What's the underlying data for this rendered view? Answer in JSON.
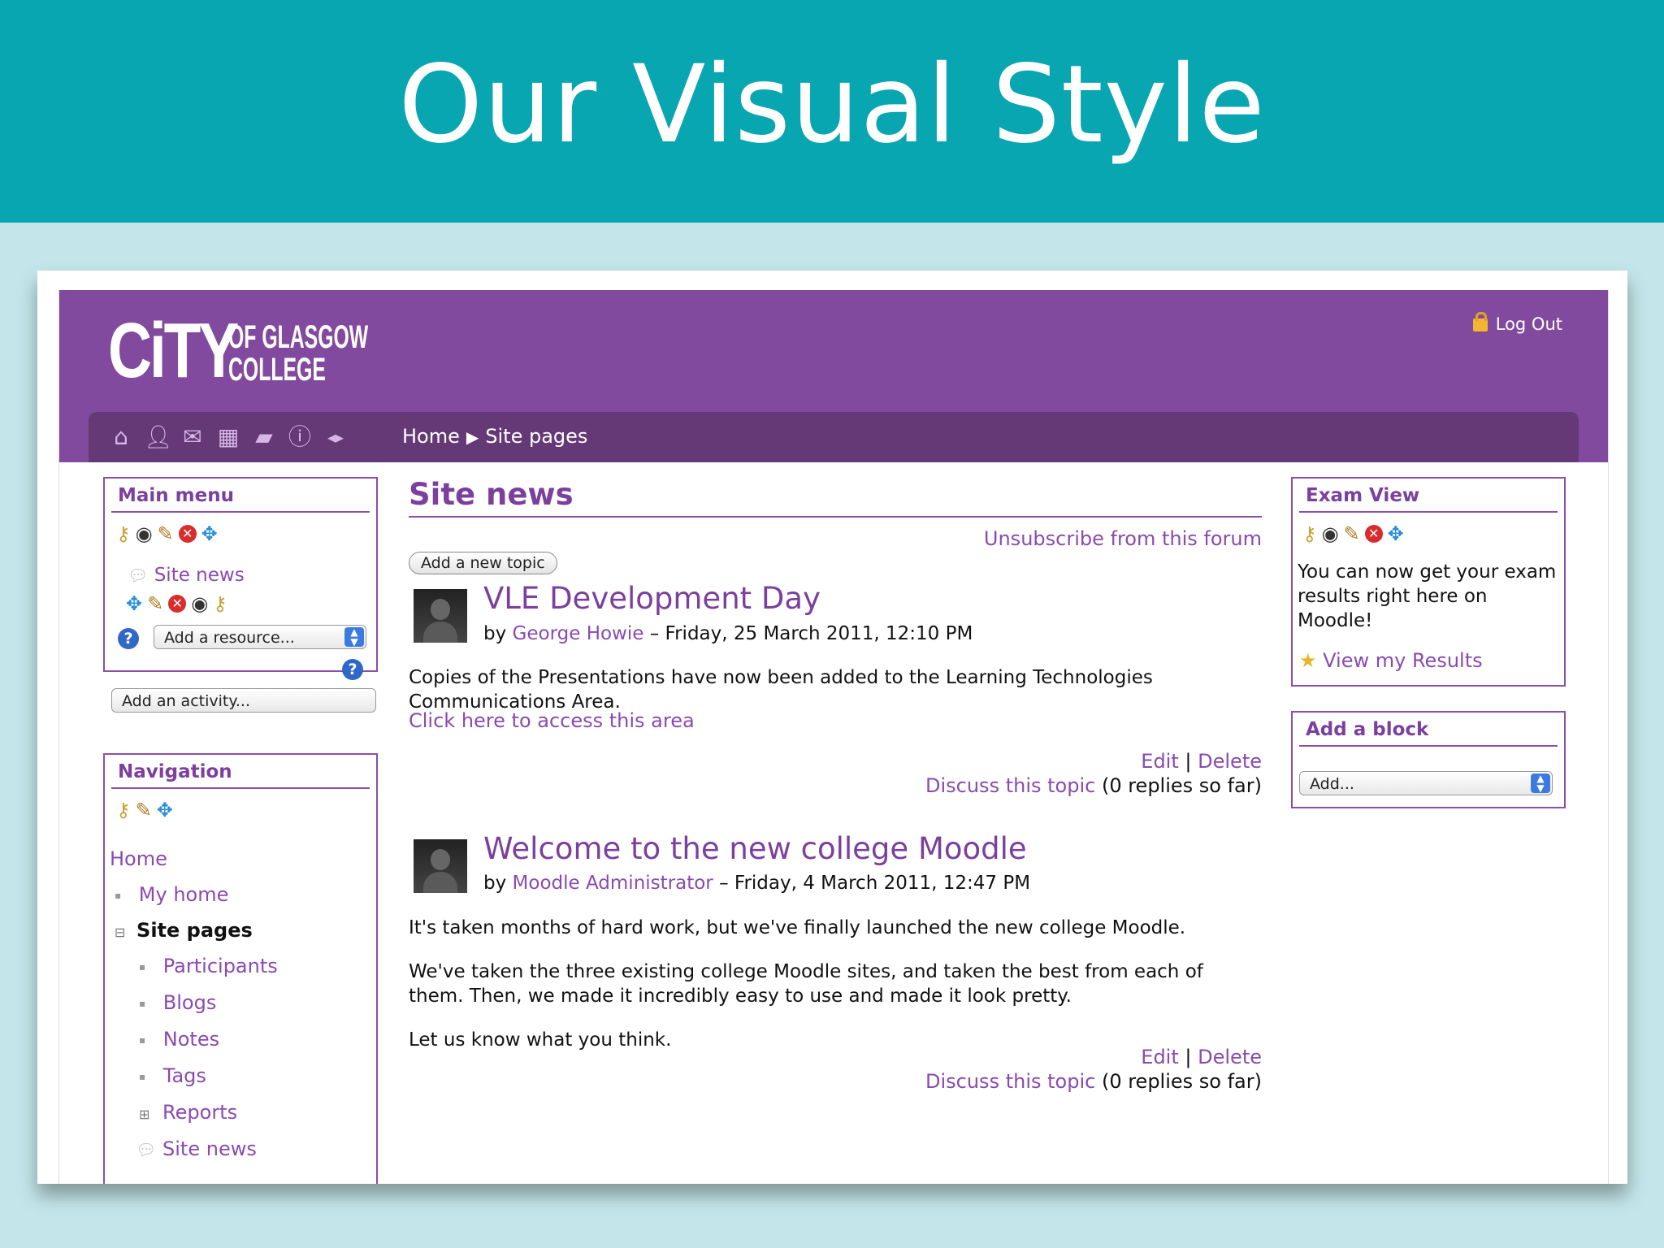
{
  "slide": {
    "title": "Our Visual Style"
  },
  "header": {
    "logo_city": "CiTY",
    "logo_line1": "OF GLASGOW",
    "logo_line2": "COLLEGE",
    "logout": "Log Out"
  },
  "navbar": {
    "icons": [
      "home-icon",
      "user-icon",
      "mail-icon",
      "calendar-icon",
      "folder-icon",
      "help-icon",
      "collapse-icon"
    ],
    "breadcrumb": [
      "Home",
      "Site pages"
    ]
  },
  "main_menu": {
    "title": "Main menu",
    "item": "Site news",
    "resource_select": "Add a resource...",
    "activity_select": "Add an activity..."
  },
  "navigation": {
    "title": "Navigation",
    "home": "Home",
    "my_home": "My home",
    "site_pages": "Site pages",
    "children": [
      "Participants",
      "Blogs",
      "Notes",
      "Tags",
      "Reports",
      "Site news"
    ]
  },
  "main": {
    "heading": "Site news",
    "unsubscribe": "Unsubscribe from this forum",
    "add_topic": "Add a new topic",
    "posts": [
      {
        "title": "VLE Development Day",
        "by": "by",
        "author": "George Howie",
        "date": "– Friday, 25 March 2011, 12:10 PM",
        "body": "Copies of the Presentations have now been added to the Learning Technologies Communications Area.",
        "link": "Click here to access this area",
        "edit": "Edit",
        "sep": "|",
        "delete": "Delete",
        "discuss": "Discuss this topic",
        "replies": "(0 replies so far)"
      },
      {
        "title": "Welcome to the new college Moodle",
        "by": "by",
        "author": "Moodle Administrator",
        "date": "– Friday, 4 March 2011, 12:47 PM",
        "para1": "It's taken months of hard work, but we've finally launched the new college Moodle.",
        "para2": "We've taken the three existing college Moodle sites, and taken the best from each of them. Then, we made it incredibly easy to use and made it look pretty.",
        "para3": "Let us know what you think.",
        "edit": "Edit",
        "sep": "|",
        "delete": "Delete",
        "discuss": "Discuss this topic",
        "replies": "(0 replies so far)"
      }
    ]
  },
  "exam_view": {
    "title": "Exam View",
    "text": "You can now get your exam results right here on Moodle!",
    "link": "View my Results"
  },
  "add_block": {
    "title": "Add a block",
    "select": "Add..."
  }
}
